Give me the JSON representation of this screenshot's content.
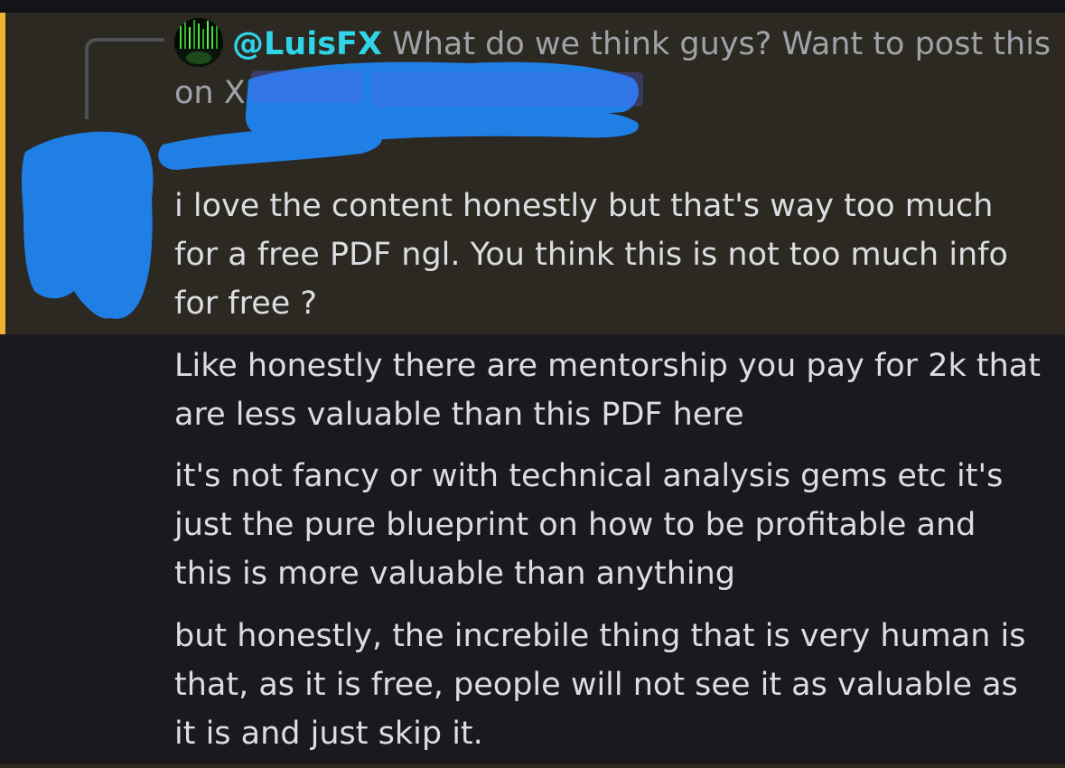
{
  "reply": {
    "author_mention": "@LuisFX",
    "preview_text": "What do we think guys? Want to post this on X"
  },
  "messages": [
    {
      "text": "i love the content honestly but that's way too much for a free PDF ngl. You think this is not too much info for free ?"
    },
    {
      "text": "Like honestly there are mentorship you pay for 2k that are less valuable than this PDF here"
    },
    {
      "text": "it's not fancy or with technical analysis gems etc it's just the pure blueprint on how to be profitable and this is more valuable than anything"
    },
    {
      "text": "but honestly, the increbile thing that is very human is that, as it is free, people will not see it as valuable as it is and just skip it."
    }
  ],
  "colors": {
    "background": "#1a1a1e",
    "highlight_background": "#2c2922",
    "highlight_bar": "#f0b232",
    "mention": "#2fd4e6",
    "message_text": "#dcdde2",
    "reply_text": "#9fa2a8",
    "redaction": "#1f7fe5"
  },
  "icons": {
    "reply_avatar": "matrix-avatar-icon"
  }
}
